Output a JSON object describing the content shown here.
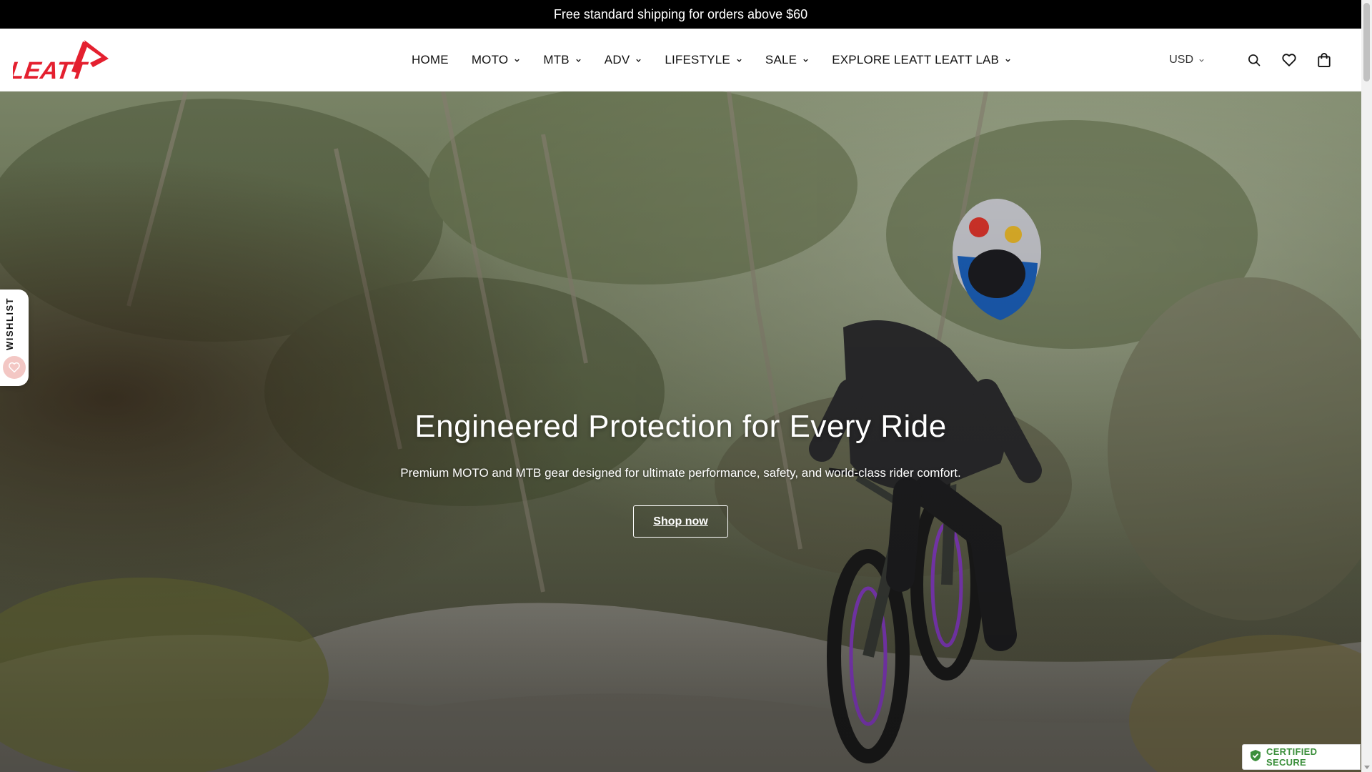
{
  "announcement": {
    "text": "Free standard shipping for orders above $60"
  },
  "brand": {
    "logo_text": "LEATT",
    "color": "#e4202f"
  },
  "nav": {
    "items": [
      {
        "label": "HOME",
        "has_dropdown": false
      },
      {
        "label": "MOTO",
        "has_dropdown": true
      },
      {
        "label": "MTB",
        "has_dropdown": true
      },
      {
        "label": "ADV",
        "has_dropdown": true
      },
      {
        "label": "LIFESTYLE",
        "has_dropdown": true
      },
      {
        "label": "SALE",
        "has_dropdown": true
      },
      {
        "label": "EXPLORE LEATT LEATT LAB",
        "has_dropdown": true
      }
    ]
  },
  "header_right": {
    "currency": "USD",
    "icons": [
      "search-icon",
      "heart-icon",
      "shopping-bag-icon"
    ]
  },
  "hero": {
    "title": "Engineered Protection for Every Ride",
    "subtitle": "Premium MOTO and MTB gear designed for ultimate performance, safety, and world-class rider comfort.",
    "cta_label": "Shop now"
  },
  "wishlist_tab": {
    "label": "WISHLIST"
  },
  "secure_badge": {
    "label": "CERTIFIED SECURE",
    "color": "#3b8f3b"
  }
}
